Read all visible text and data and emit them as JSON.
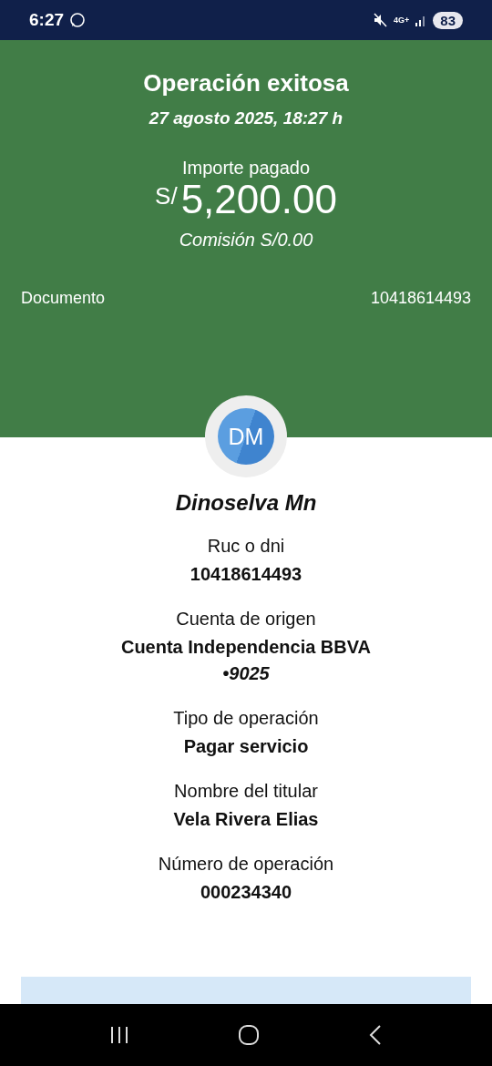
{
  "status_bar": {
    "time": "6:27",
    "network": "4G+",
    "battery": "83"
  },
  "header": {
    "title": "Operación exitosa",
    "date": "27 agosto 2025, 18:27 h",
    "amount_label": "Importe pagado",
    "currency": "S/",
    "amount": "5,200.00",
    "commission": "Comisión  S/0.00",
    "document_label": "Documento",
    "document_value": "10418614493"
  },
  "payee": {
    "initials": "DM",
    "name": "Dinoselva Mn"
  },
  "details": [
    {
      "label": "Ruc o dni",
      "value": "10418614493"
    },
    {
      "label": "Cuenta de origen",
      "value": "Cuenta Independencia BBVA",
      "sub": "•9025"
    },
    {
      "label": "Tipo de operación",
      "value": "Pagar servicio"
    },
    {
      "label": "Nombre del titular",
      "value": "Vela Rivera Elias"
    },
    {
      "label": "Número de operación",
      "value": "000234340"
    }
  ]
}
